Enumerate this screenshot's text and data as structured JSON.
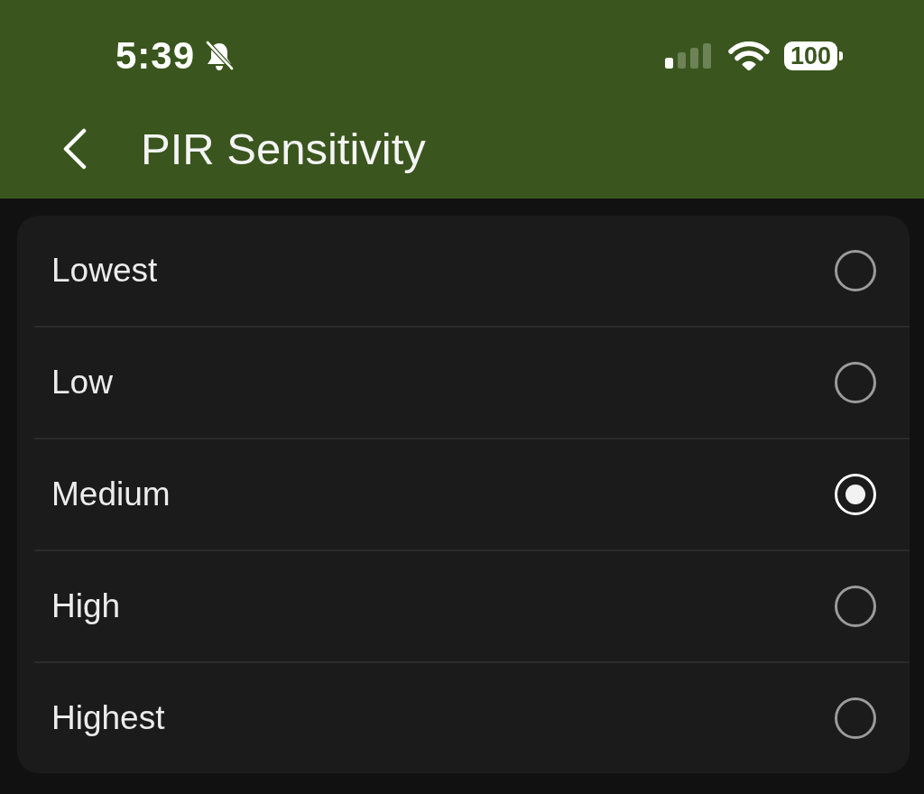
{
  "status_bar": {
    "time": "5:39",
    "battery": "100"
  },
  "header": {
    "title": "PIR Sensitivity"
  },
  "options": [
    {
      "label": "Lowest",
      "selected": false
    },
    {
      "label": "Low",
      "selected": false
    },
    {
      "label": "Medium",
      "selected": true
    },
    {
      "label": "High",
      "selected": false
    },
    {
      "label": "Highest",
      "selected": false
    }
  ]
}
